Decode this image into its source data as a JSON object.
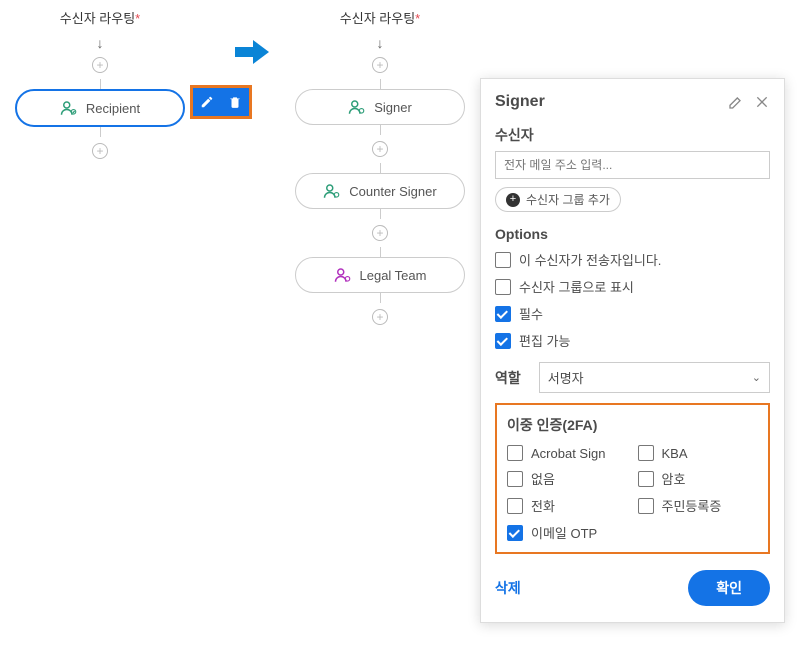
{
  "left": {
    "header": "수신자 라우팅",
    "recipient_label": "Recipient"
  },
  "right": {
    "header": "수신자 라우팅",
    "nodes": [
      "Signer",
      "Counter Signer",
      "Legal Team"
    ]
  },
  "panel": {
    "title": "Signer",
    "recipient_label": "수신자",
    "email_placeholder": "전자 메일 주소 입력...",
    "add_group_label": "수신자 그룹 추가",
    "options_label": "Options",
    "options": [
      {
        "label": "이 수신자가 전송자입니다.",
        "checked": false
      },
      {
        "label": "수신자 그룹으로 표시",
        "checked": false
      },
      {
        "label": "필수",
        "checked": true
      },
      {
        "label": "편집 가능",
        "checked": true
      }
    ],
    "role_label": "역할",
    "role_value": "서명자",
    "tfa_label": "이중 인증(2FA)",
    "tfa": [
      {
        "label": "Acrobat Sign",
        "checked": false
      },
      {
        "label": "KBA",
        "checked": false
      },
      {
        "label": "없음",
        "checked": false
      },
      {
        "label": "암호",
        "checked": false
      },
      {
        "label": "전화",
        "checked": false
      },
      {
        "label": "주민등록증",
        "checked": false
      },
      {
        "label": "이메일 OTP",
        "checked": true
      }
    ],
    "delete_label": "삭제",
    "ok_label": "확인"
  }
}
